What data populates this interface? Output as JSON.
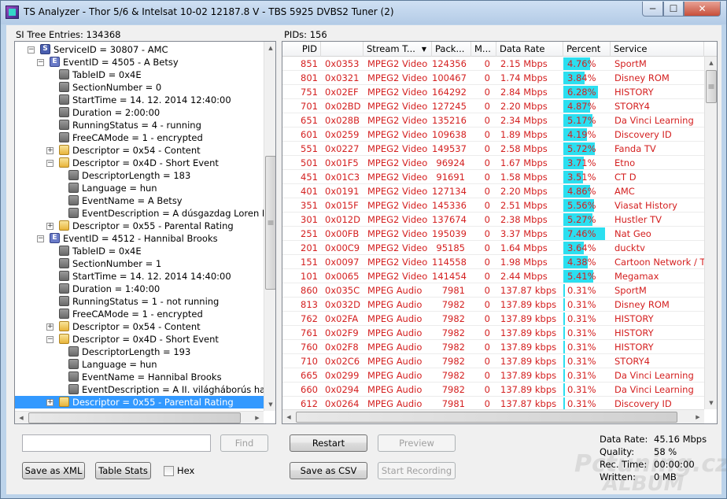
{
  "window": {
    "title": "TS Analyzer - Thor 5/6 & Intelsat 10-02 12187.8 V - TBS 5925 DVBS2 Tuner (2)",
    "min": "─",
    "max": "☐",
    "close": "✕"
  },
  "left": {
    "label": "SI Tree Entries: 134368",
    "find_placeholder": "",
    "find_label": "Find",
    "save_xml_label": "Save as XML",
    "table_stats_label": "Table Stats",
    "hex_label": "Hex"
  },
  "tree": [
    {
      "d": 2,
      "icon": "s",
      "exp": "-",
      "text": "ServiceID = 30807 - AMC"
    },
    {
      "d": 3,
      "icon": "e",
      "exp": "-",
      "text": "EventID = 4505 - A Betsy"
    },
    {
      "d": 4,
      "icon": "f",
      "exp": "",
      "text": "TableID = 0x4E"
    },
    {
      "d": 4,
      "icon": "f",
      "exp": "",
      "text": "SectionNumber = 0"
    },
    {
      "d": 4,
      "icon": "f",
      "exp": "",
      "text": "StartTime = 14. 12. 2014 12:40:00"
    },
    {
      "d": 4,
      "icon": "f",
      "exp": "",
      "text": "Duration = 2:00:00"
    },
    {
      "d": 4,
      "icon": "f",
      "exp": "",
      "text": "RunningStatus = 4 - running"
    },
    {
      "d": 4,
      "icon": "f",
      "exp": "",
      "text": "FreeCAMode = 1 - encrypted"
    },
    {
      "d": 4,
      "icon": "d",
      "exp": "+",
      "text": "Descriptor = 0x54 - Content"
    },
    {
      "d": 4,
      "icon": "d",
      "exp": "-",
      "text": "Descriptor = 0x4D - Short Event"
    },
    {
      "d": 5,
      "icon": "f",
      "exp": "",
      "text": "DescriptorLength = 183"
    },
    {
      "d": 5,
      "icon": "f",
      "exp": "",
      "text": "Language = hun"
    },
    {
      "d": 5,
      "icon": "f",
      "exp": "",
      "text": "EventName = A Betsy"
    },
    {
      "d": 5,
      "icon": "f",
      "exp": "",
      "text": "EventDescription = A dúsgazdag Loren H"
    },
    {
      "d": 4,
      "icon": "d",
      "exp": "+",
      "text": "Descriptor = 0x55 - Parental Rating"
    },
    {
      "d": 3,
      "icon": "e",
      "exp": "-",
      "text": "EventID = 4512 - Hannibal Brooks"
    },
    {
      "d": 4,
      "icon": "f",
      "exp": "",
      "text": "TableID = 0x4E"
    },
    {
      "d": 4,
      "icon": "f",
      "exp": "",
      "text": "SectionNumber = 1"
    },
    {
      "d": 4,
      "icon": "f",
      "exp": "",
      "text": "StartTime = 14. 12. 2014 14:40:00"
    },
    {
      "d": 4,
      "icon": "f",
      "exp": "",
      "text": "Duration = 1:40:00"
    },
    {
      "d": 4,
      "icon": "f",
      "exp": "",
      "text": "RunningStatus = 1 - not running"
    },
    {
      "d": 4,
      "icon": "f",
      "exp": "",
      "text": "FreeCAMode = 1 - encrypted"
    },
    {
      "d": 4,
      "icon": "d",
      "exp": "+",
      "text": "Descriptor = 0x54 - Content"
    },
    {
      "d": 4,
      "icon": "d",
      "exp": "-",
      "text": "Descriptor = 0x4D - Short Event"
    },
    {
      "d": 5,
      "icon": "f",
      "exp": "",
      "text": "DescriptorLength = 193"
    },
    {
      "d": 5,
      "icon": "f",
      "exp": "",
      "text": "Language = hun"
    },
    {
      "d": 5,
      "icon": "f",
      "exp": "",
      "text": "EventName = Hannibal Brooks"
    },
    {
      "d": 5,
      "icon": "f",
      "exp": "",
      "text": "EventDescription = A II. világháborús ha"
    },
    {
      "d": 4,
      "icon": "d",
      "exp": "+",
      "text": "Descriptor = 0x55 - Parental Rating"
    }
  ],
  "right": {
    "label": "PIDs: 156",
    "restart_label": "Restart",
    "preview_label": "Preview",
    "save_csv_label": "Save as CSV",
    "start_rec_label": "Start Recording"
  },
  "columns": [
    "PID",
    "",
    "Stream T...",
    "Pack...",
    "M...",
    "Data Rate",
    "Percent",
    "Service"
  ],
  "rows": [
    {
      "pid": "851",
      "hex": "0x0353",
      "type": "MPEG2 Video",
      "pack": "124356",
      "m": "0",
      "rate": "2.15 Mbps",
      "pct": "4.76%",
      "pv": 4.76,
      "svc": "SportM",
      "red": true
    },
    {
      "pid": "801",
      "hex": "0x0321",
      "type": "MPEG2 Video",
      "pack": "100467",
      "m": "0",
      "rate": "1.74 Mbps",
      "pct": "3.84%",
      "pv": 3.84,
      "svc": "Disney ROM",
      "red": true
    },
    {
      "pid": "751",
      "hex": "0x02EF",
      "type": "MPEG2 Video",
      "pack": "164292",
      "m": "0",
      "rate": "2.84 Mbps",
      "pct": "6.28%",
      "pv": 6.28,
      "svc": "HISTORY",
      "red": true
    },
    {
      "pid": "701",
      "hex": "0x02BD",
      "type": "MPEG2 Video",
      "pack": "127245",
      "m": "0",
      "rate": "2.20 Mbps",
      "pct": "4.87%",
      "pv": 4.87,
      "svc": "STORY4",
      "red": true
    },
    {
      "pid": "651",
      "hex": "0x028B",
      "type": "MPEG2 Video",
      "pack": "135216",
      "m": "0",
      "rate": "2.34 Mbps",
      "pct": "5.17%",
      "pv": 5.17,
      "svc": "Da Vinci Learning",
      "red": true
    },
    {
      "pid": "601",
      "hex": "0x0259",
      "type": "MPEG2 Video",
      "pack": "109638",
      "m": "0",
      "rate": "1.89 Mbps",
      "pct": "4.19%",
      "pv": 4.19,
      "svc": "Discovery ID",
      "red": true
    },
    {
      "pid": "551",
      "hex": "0x0227",
      "type": "MPEG2 Video",
      "pack": "149537",
      "m": "0",
      "rate": "2.58 Mbps",
      "pct": "5.72%",
      "pv": 5.72,
      "svc": "Fanda TV",
      "red": true
    },
    {
      "pid": "501",
      "hex": "0x01F5",
      "type": "MPEG2 Video",
      "pack": "96924",
      "m": "0",
      "rate": "1.67 Mbps",
      "pct": "3.71%",
      "pv": 3.71,
      "svc": "Etno",
      "red": true
    },
    {
      "pid": "451",
      "hex": "0x01C3",
      "type": "MPEG2 Video",
      "pack": "91691",
      "m": "0",
      "rate": "1.58 Mbps",
      "pct": "3.51%",
      "pv": 3.51,
      "svc": "CT D",
      "red": true
    },
    {
      "pid": "401",
      "hex": "0x0191",
      "type": "MPEG2 Video",
      "pack": "127134",
      "m": "0",
      "rate": "2.20 Mbps",
      "pct": "4.86%",
      "pv": 4.86,
      "svc": "AMC",
      "red": true
    },
    {
      "pid": "351",
      "hex": "0x015F",
      "type": "MPEG2 Video",
      "pack": "145336",
      "m": "0",
      "rate": "2.51 Mbps",
      "pct": "5.56%",
      "pv": 5.56,
      "svc": "Viasat History",
      "red": true
    },
    {
      "pid": "301",
      "hex": "0x012D",
      "type": "MPEG2 Video",
      "pack": "137674",
      "m": "0",
      "rate": "2.38 Mbps",
      "pct": "5.27%",
      "pv": 5.27,
      "svc": "Hustler TV",
      "red": true
    },
    {
      "pid": "251",
      "hex": "0x00FB",
      "type": "MPEG2 Video",
      "pack": "195039",
      "m": "0",
      "rate": "3.37 Mbps",
      "pct": "7.46%",
      "pv": 7.46,
      "svc": "Nat Geo",
      "red": true
    },
    {
      "pid": "201",
      "hex": "0x00C9",
      "type": "MPEG2 Video",
      "pack": "95185",
      "m": "0",
      "rate": "1.64 Mbps",
      "pct": "3.64%",
      "pv": 3.64,
      "svc": "ducktv",
      "red": true
    },
    {
      "pid": "151",
      "hex": "0x0097",
      "type": "MPEG2 Video",
      "pack": "114558",
      "m": "0",
      "rate": "1.98 Mbps",
      "pct": "4.38%",
      "pv": 4.38,
      "svc": "Cartoon Network / T",
      "red": true
    },
    {
      "pid": "101",
      "hex": "0x0065",
      "type": "MPEG2 Video",
      "pack": "141454",
      "m": "0",
      "rate": "2.44 Mbps",
      "pct": "5.41%",
      "pv": 5.41,
      "svc": "Megamax",
      "red": true
    },
    {
      "pid": "860",
      "hex": "0x035C",
      "type": "MPEG Audio",
      "pack": "7981",
      "m": "0",
      "rate": "137.87 kbps",
      "pct": "0.31%",
      "pv": 0.31,
      "svc": "SportM",
      "red": true
    },
    {
      "pid": "813",
      "hex": "0x032D",
      "type": "MPEG Audio",
      "pack": "7982",
      "m": "0",
      "rate": "137.89 kbps",
      "pct": "0.31%",
      "pv": 0.31,
      "svc": "Disney ROM",
      "red": true
    },
    {
      "pid": "762",
      "hex": "0x02FA",
      "type": "MPEG Audio",
      "pack": "7982",
      "m": "0",
      "rate": "137.89 kbps",
      "pct": "0.31%",
      "pv": 0.31,
      "svc": "HISTORY",
      "red": true
    },
    {
      "pid": "761",
      "hex": "0x02F9",
      "type": "MPEG Audio",
      "pack": "7982",
      "m": "0",
      "rate": "137.89 kbps",
      "pct": "0.31%",
      "pv": 0.31,
      "svc": "HISTORY",
      "red": true
    },
    {
      "pid": "760",
      "hex": "0x02F8",
      "type": "MPEG Audio",
      "pack": "7982",
      "m": "0",
      "rate": "137.89 kbps",
      "pct": "0.31%",
      "pv": 0.31,
      "svc": "HISTORY",
      "red": true
    },
    {
      "pid": "710",
      "hex": "0x02C6",
      "type": "MPEG Audio",
      "pack": "7982",
      "m": "0",
      "rate": "137.89 kbps",
      "pct": "0.31%",
      "pv": 0.31,
      "svc": "STORY4",
      "red": true
    },
    {
      "pid": "665",
      "hex": "0x0299",
      "type": "MPEG Audio",
      "pack": "7982",
      "m": "0",
      "rate": "137.89 kbps",
      "pct": "0.31%",
      "pv": 0.31,
      "svc": "Da Vinci Learning",
      "red": true
    },
    {
      "pid": "660",
      "hex": "0x0294",
      "type": "MPEG Audio",
      "pack": "7982",
      "m": "0",
      "rate": "137.89 kbps",
      "pct": "0.31%",
      "pv": 0.31,
      "svc": "Da Vinci Learning",
      "red": true
    },
    {
      "pid": "612",
      "hex": "0x0264",
      "type": "MPEG Audio",
      "pack": "7981",
      "m": "0",
      "rate": "137.87 kbps",
      "pct": "0.31%",
      "pv": 0.31,
      "svc": "Discovery ID",
      "red": true
    }
  ],
  "stats": {
    "data_rate_label": "Data Rate:",
    "data_rate": "45.16 Mbps",
    "quality_label": "Quality:",
    "quality": "58 %",
    "rec_time_label": "Rec. Time:",
    "rec_time": "00:00:00",
    "written_label": "Written:",
    "written": "0 MB"
  },
  "watermark": {
    "line1": "Pctuning.cz",
    "line2": "ALBUM"
  },
  "colors": {
    "accent": "#3399ff",
    "bar": "#2bdff0",
    "red_text": "#d42020"
  }
}
